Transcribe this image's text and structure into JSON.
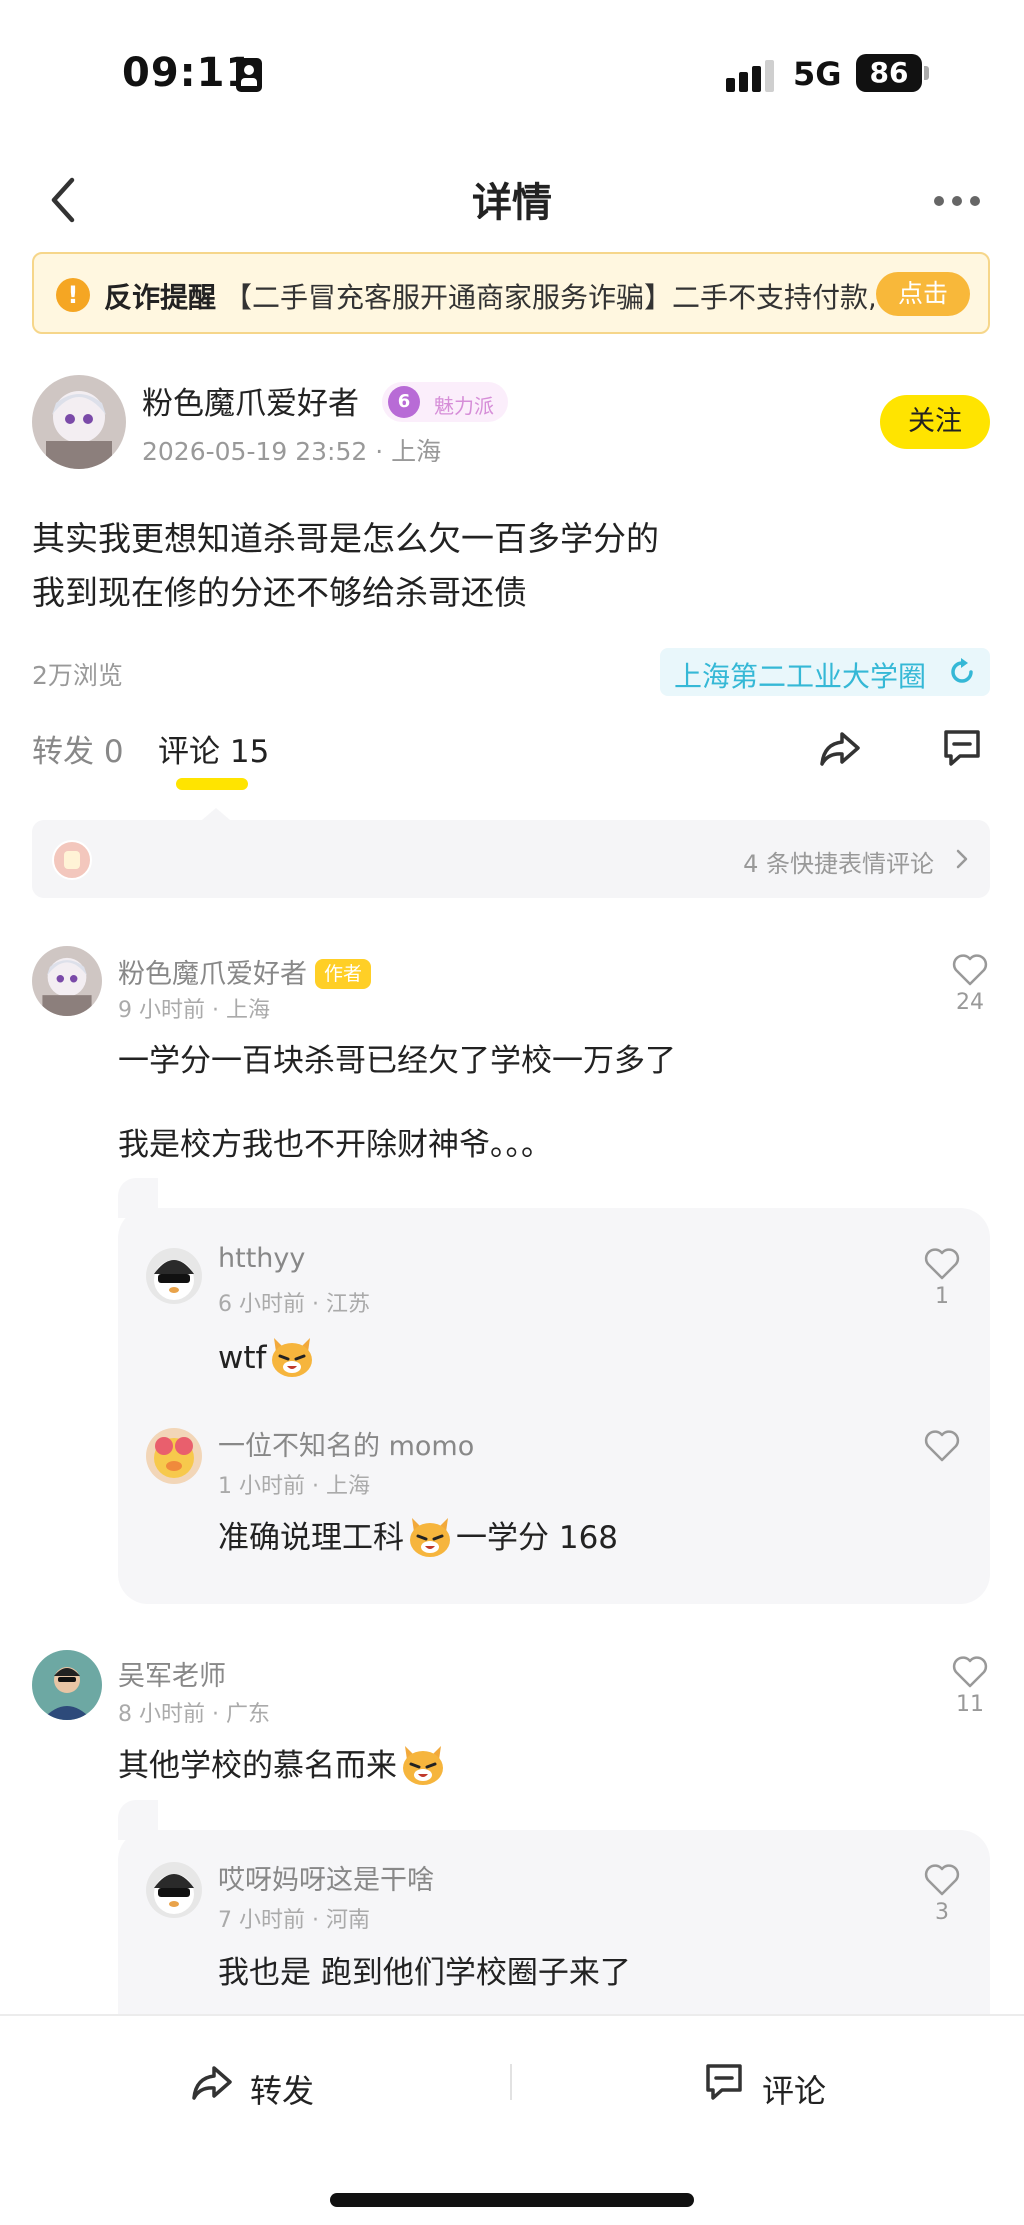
{
  "status_bar": {
    "time": "09:11",
    "network": "5G",
    "battery": "86"
  },
  "nav": {
    "title": "详情"
  },
  "banner": {
    "title": "反诈提醒",
    "text": "【二手冒充客服开通商家服务诈骗】二手不支持付款,",
    "button": "点击"
  },
  "post": {
    "author": "粉色魔爪爱好者",
    "level": "6",
    "level_label": "魅力派",
    "meta": "2026-05-19 23:52 · 上海",
    "follow": "关注",
    "body_line1": "其实我更想知道杀哥是怎么欠一百多学分的",
    "body_line2": "我到现在修的分还不够给杀哥还债",
    "views": "2万浏览",
    "circle": "上海第二工业大学圈"
  },
  "tabs": {
    "repost": "转发 0",
    "comment": "评论 15"
  },
  "reactions": {
    "text": "4 条快捷表情评论"
  },
  "comments": [
    {
      "name": "粉色魔爪爱好者",
      "tag": "作者",
      "meta": "9 小时前 · 上海",
      "likes": "24",
      "text_line1": "一学分一百块杀哥已经欠了学校一万多了",
      "text_line2": "我是校方我也不开除财神爷。。。",
      "replies": [
        {
          "name": "htthyy",
          "meta": "6 小时前 · 江苏",
          "likes": "1",
          "text": "wtf"
        },
        {
          "name": "一位不知名的 momo",
          "meta": "1 小时前 · 上海",
          "likes": "",
          "text_before": "准确说理工科",
          "text_after": "一学分 168"
        }
      ]
    },
    {
      "name": "吴军老师",
      "meta": "8 小时前 · 广东",
      "likes": "11",
      "text": "其他学校的慕名而来",
      "replies": [
        {
          "name": "哎呀妈呀这是干啥",
          "meta": "7 小时前 · 河南",
          "likes": "3",
          "text": "我也是 跑到他们学校圈子来了"
        }
      ]
    }
  ],
  "bottom_bar": {
    "repost": "转发",
    "comment": "评论"
  },
  "colors": {
    "accent": "#ffe400",
    "circle_text": "#35b8d6",
    "banner_bg": "#fff7e0"
  }
}
